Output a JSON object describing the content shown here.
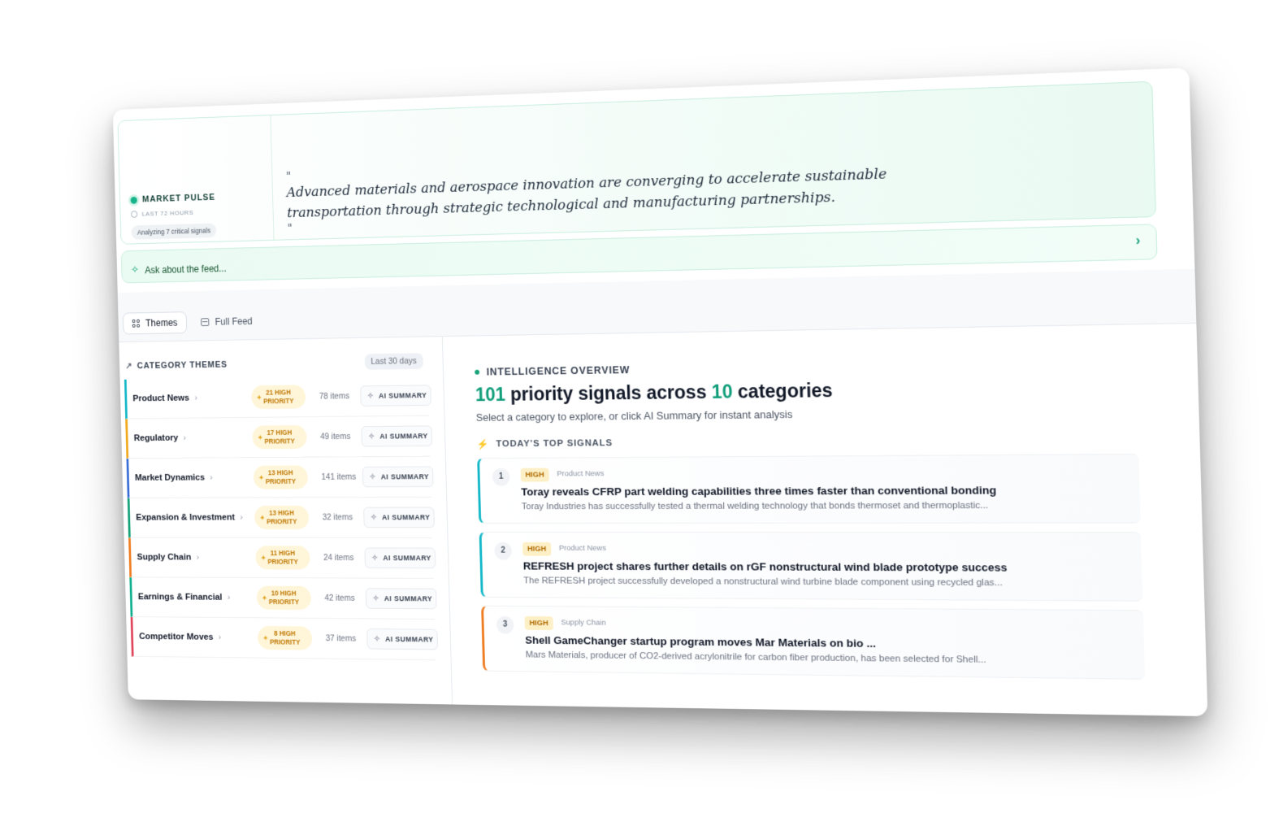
{
  "market_pulse": {
    "title": "MARKET PULSE",
    "time_range": "LAST 72 HOURS",
    "chip": "Analyzing 7 critical signals",
    "quote_open": "\"",
    "quote": "Advanced materials and aerospace innovation are converging to accelerate sustainable transportation through strategic technological and manufacturing partnerships.",
    "quote_close": "\""
  },
  "ask": {
    "placeholder": "Ask about the feed...",
    "icon": "sparkle-icon",
    "arrow_icon": "chevron-right-icon"
  },
  "tabs": [
    {
      "label": "Themes",
      "icon": "grid-icon",
      "active": true
    },
    {
      "label": "Full Feed",
      "icon": "list-icon",
      "active": false
    }
  ],
  "category_themes": {
    "title": "CATEGORY THEMES",
    "period": "Last 30 days",
    "ai_label": "AI SUMMARY",
    "rows": [
      {
        "name": "Product News",
        "priority_line1": "21 HIGH",
        "priority_line2": "PRIORITY",
        "items": "78 items",
        "color": "#14b8c8"
      },
      {
        "name": "Regulatory",
        "priority_line1": "17 HIGH",
        "priority_line2": "PRIORITY",
        "items": "49 items",
        "color": "#f0a81c"
      },
      {
        "name": "Market Dynamics",
        "priority_line1": "13 HIGH",
        "priority_line2": "PRIORITY",
        "items": "141 items",
        "color": "#3b6fd8"
      },
      {
        "name": "Expansion & Investment",
        "priority_line1": "13 HIGH",
        "priority_line2": "PRIORITY",
        "items": "32 items",
        "color": "#16a37a"
      },
      {
        "name": "Supply Chain",
        "priority_line1": "11 HIGH",
        "priority_line2": "PRIORITY",
        "items": "24 items",
        "color": "#ef7d22"
      },
      {
        "name": "Earnings & Financial",
        "priority_line1": "10 HIGH",
        "priority_line2": "PRIORITY",
        "items": "42 items",
        "color": "#10b08f"
      },
      {
        "name": "Competitor Moves",
        "priority_line1": "8 HIGH",
        "priority_line2": "PRIORITY",
        "items": "37 items",
        "color": "#e0475e"
      }
    ]
  },
  "overview": {
    "label": "INTELLIGENCE OVERVIEW",
    "count_signals": "101",
    "mid_text": " priority signals across ",
    "count_categories": "10",
    "end_text": " categories",
    "subtitle": "Select a category to explore, or click AI Summary for instant analysis",
    "top_signals_label": "TODAY'S TOP SIGNALS",
    "signals": [
      {
        "rank": "1",
        "badge": "HIGH",
        "category": "Product News",
        "title": "Toray reveals CFRP part welding capabilities three times faster than conventional bonding",
        "desc": "Toray Industries has successfully tested a thermal welding technology that bonds thermoset and thermoplastic...",
        "color": "#14b8c8"
      },
      {
        "rank": "2",
        "badge": "HIGH",
        "category": "Product News",
        "title": "REFRESH project shares further details on rGF nonstructural wind blade prototype success",
        "desc": "The REFRESH project successfully developed a nonstructural wind turbine blade component using recycled glas...",
        "color": "#14b8c8"
      },
      {
        "rank": "3",
        "badge": "HIGH",
        "category": "Supply Chain",
        "title": "Shell GameChanger startup program moves Mar Materials on bio ...",
        "desc": "Mars Materials, producer of CO2-derived acrylonitrile for carbon fiber production, has been selected for Shell...",
        "color": "#ef7d22"
      }
    ]
  }
}
